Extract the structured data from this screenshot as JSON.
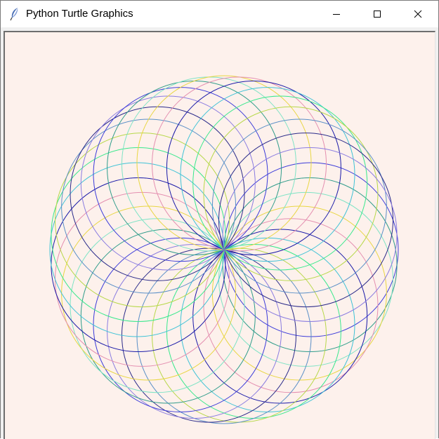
{
  "window": {
    "title": "Python Turtle Graphics",
    "icons": {
      "app": "feather-icon",
      "minimize": "minimize-icon",
      "maximize": "maximize-icon",
      "close": "close-icon"
    }
  },
  "canvas": {
    "background": "#fdf1ec",
    "circle_count": 36,
    "palette": [
      "#3b3bd9",
      "#2f9c8a",
      "#7fe3c5",
      "#e8d642",
      "#e48fb0",
      "#1a1aa8",
      "#3fc2d6",
      "#38e88c",
      "#b7d84a",
      "#5a8fc7",
      "#2b2b8a",
      "#8a7ce0"
    ]
  }
}
